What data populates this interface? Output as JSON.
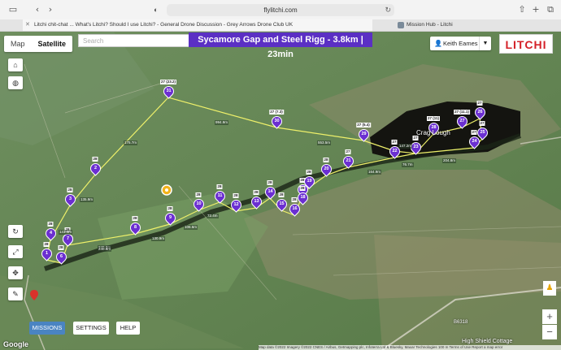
{
  "browser": {
    "url": "flylitchi.com",
    "tabs": [
      {
        "title": "Litchi chit-chat ... What's Litchi? Should I use Litchi? - General Drone Discussion - Grey Arrows Drone Club UK",
        "active": true
      },
      {
        "title": "Mission Hub - Litchi",
        "active": false
      }
    ]
  },
  "map": {
    "type_buttons": [
      "Map",
      "Satellite"
    ],
    "selected_type": "Satellite",
    "search_placeholder": "Search",
    "mission_title": "Sycamore Gap and Steel Rigg - 3.8km | 23min",
    "user_name": "Keith Eames",
    "logo_text": "LITCHI",
    "places": [
      "Crag Lough",
      "High Shield Cottage",
      "B6318"
    ],
    "google_label": "Google",
    "attribution": "Map data ©2022 Imagery ©2022 CNES / Airbus, Getmapping plc, Infoterra Ltd & Bluesky, Maxar Technologies    100 m    Terms of Use    Report a map error"
  },
  "bottom_buttons": [
    "MISSIONS",
    "SETTINGS",
    "HELP"
  ],
  "colors": {
    "accent": "#5b2fc4",
    "marker": "#6b2fd1",
    "path": "#eef06a",
    "brand": "#d41f26"
  },
  "waypoints": [
    {
      "n": "1",
      "alt": "28"
    },
    {
      "n": "2",
      "alt": "28"
    },
    {
      "n": "3",
      "alt": "28"
    },
    {
      "n": "4",
      "alt": "28"
    },
    {
      "n": "5",
      "alt": "28"
    },
    {
      "n": "6",
      "alt": "28"
    },
    {
      "n": "7",
      "alt": "28"
    },
    {
      "n": "8",
      "alt": "28"
    },
    {
      "n": "9",
      "alt": "28"
    },
    {
      "n": "10",
      "alt": "28"
    },
    {
      "n": "11",
      "alt": "28"
    },
    {
      "n": "12",
      "alt": "28"
    },
    {
      "n": "13",
      "alt": "28"
    },
    {
      "n": "14",
      "alt": "28"
    },
    {
      "n": "15",
      "alt": "28"
    },
    {
      "n": "16",
      "alt": "28"
    },
    {
      "n": "17",
      "alt": "28"
    },
    {
      "n": "18",
      "alt": "28"
    },
    {
      "n": "19",
      "alt": "28"
    },
    {
      "n": "20",
      "alt": "28"
    },
    {
      "n": "21",
      "alt": "27"
    },
    {
      "n": "22",
      "alt": "27"
    },
    {
      "n": "23",
      "alt": "27"
    },
    {
      "n": "24",
      "alt": "27"
    },
    {
      "n": "25",
      "alt": "27"
    },
    {
      "n": "26",
      "alt": "27"
    },
    {
      "n": "27",
      "alt": "27 (11.1)"
    },
    {
      "n": "28",
      "alt": "27 (11)"
    },
    {
      "n": "29",
      "alt": "27 (5.4)"
    },
    {
      "n": "30",
      "alt": "27 (7.3)"
    },
    {
      "n": "31",
      "alt": "27 (23.2)"
    }
  ],
  "distances": [
    "175.7m",
    "994.9m",
    "553.5m",
    "135.9m",
    "141.4m",
    "240.8m",
    "130.9m",
    "106.6m",
    "72.4m",
    "164.9m",
    "76.7m",
    "204.8m",
    "240.8m",
    "147.2m"
  ]
}
